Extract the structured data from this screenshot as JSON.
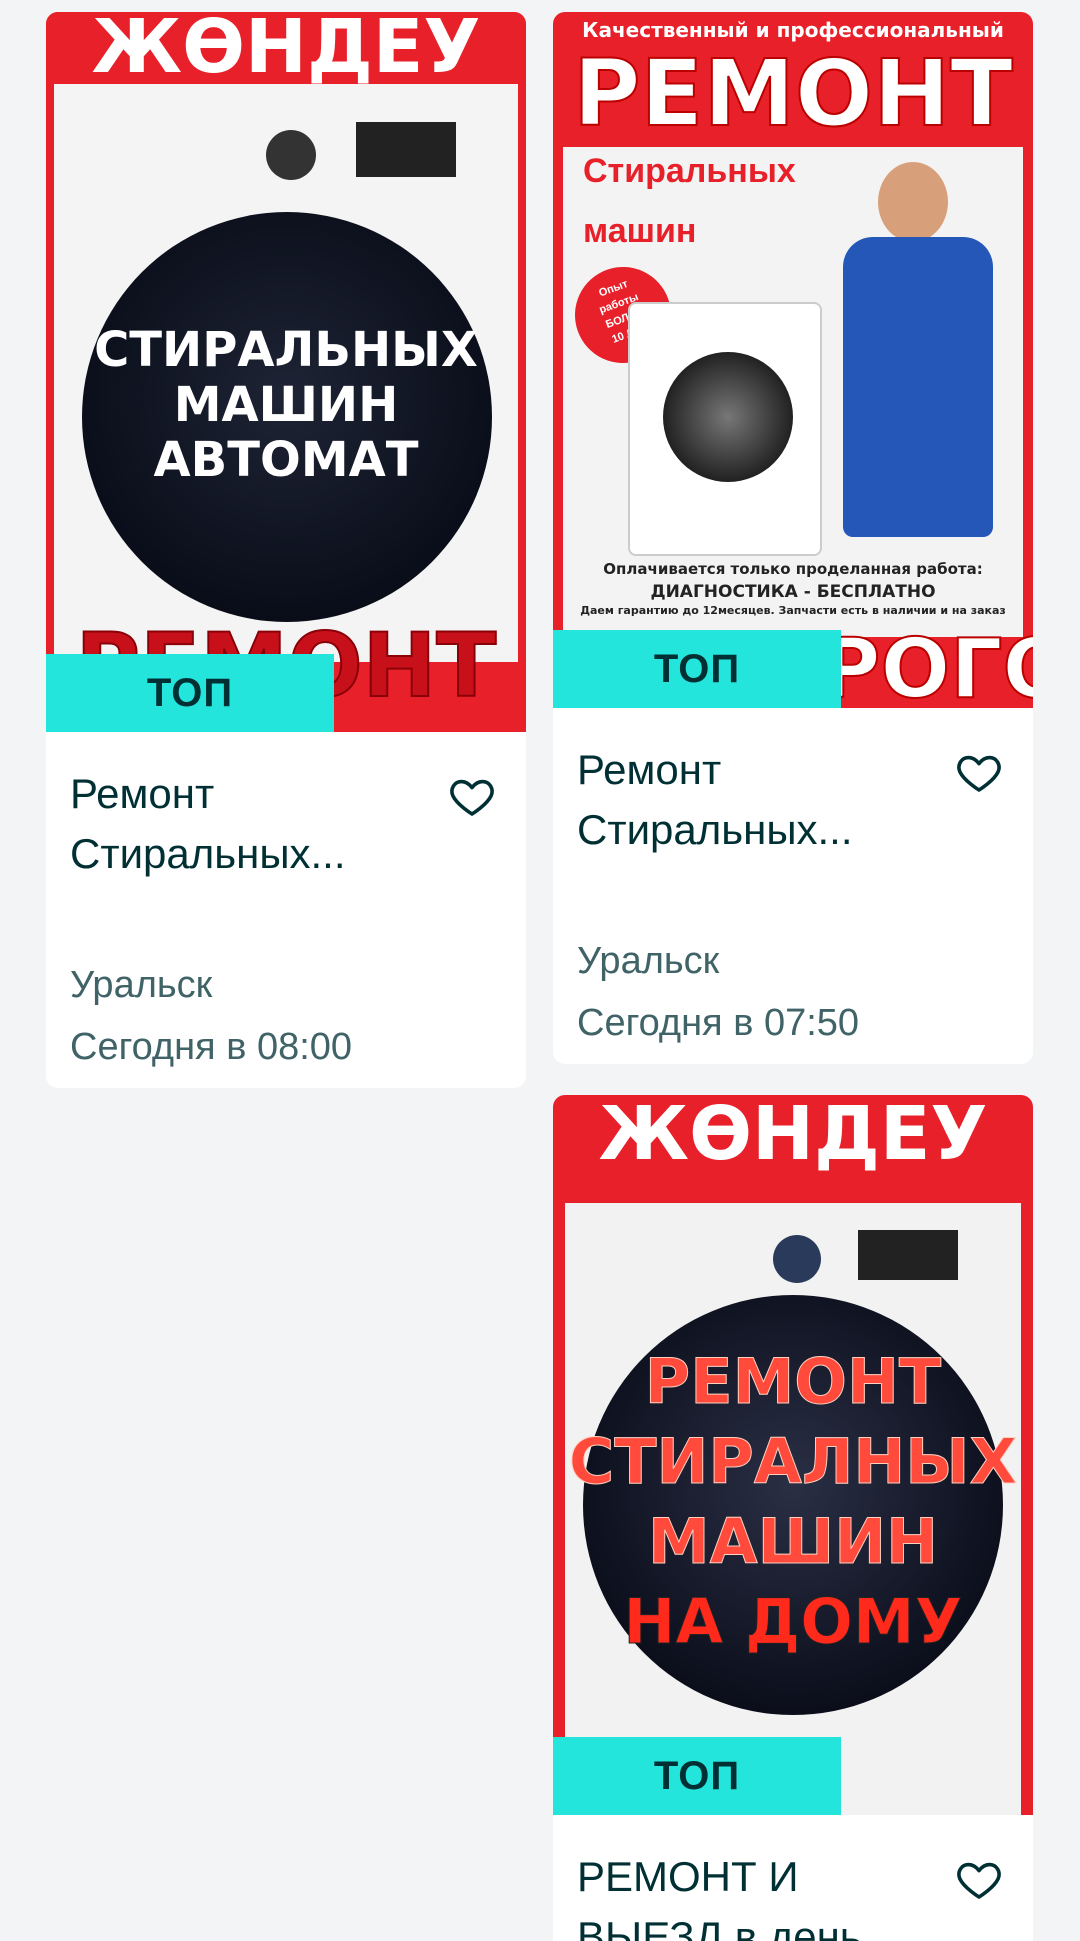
{
  "listings": [
    {
      "badge": "ТОП",
      "title": "Ремонт Стиральных...",
      "city": "Уральск",
      "date": "Сегодня в 08:00",
      "poster": {
        "top": "ЖӨНДЕУ",
        "center": [
          "СТИРАЛЬНЫХ",
          "МАШИН",
          "АВТОМАТ"
        ],
        "bottom": "РЕМОНТ"
      }
    },
    {
      "badge": "ТОП",
      "title": "Ремонт Стиральных...",
      "city": "Уральск",
      "date": "Сегодня в 07:50",
      "poster": {
        "header": "Качественный и профессиональный",
        "big": "РЕМОНТ",
        "line1": "Стиральных",
        "line2": "машин",
        "sticker": [
          "Опыт",
          "работы",
          "БОЛЕЕ",
          "10 ЛЕТ"
        ],
        "paid": "Оплачивается только проделанная работа:",
        "diag": "ДИАГНОСТИКА - БЕСПЛАТНО",
        "warranty": "Даем гарантию до 12месяцев. Запчасти есть в наличии и на заказ",
        "bottom": "НЕДОРОГО"
      }
    },
    {
      "badge": "ТОП",
      "title": "РЕМОНТ И ВЫЕЗД в день",
      "poster": {
        "top": "ЖӨНДЕУ",
        "center": [
          "РЕМОНТ",
          "СТИРАЛНЫХ",
          "МАШИН",
          "НА ДОМУ"
        ]
      }
    }
  ],
  "colors": {
    "accent": "#23e5db",
    "text": "#002f34",
    "muted": "#406367",
    "red": "#e8202a"
  }
}
